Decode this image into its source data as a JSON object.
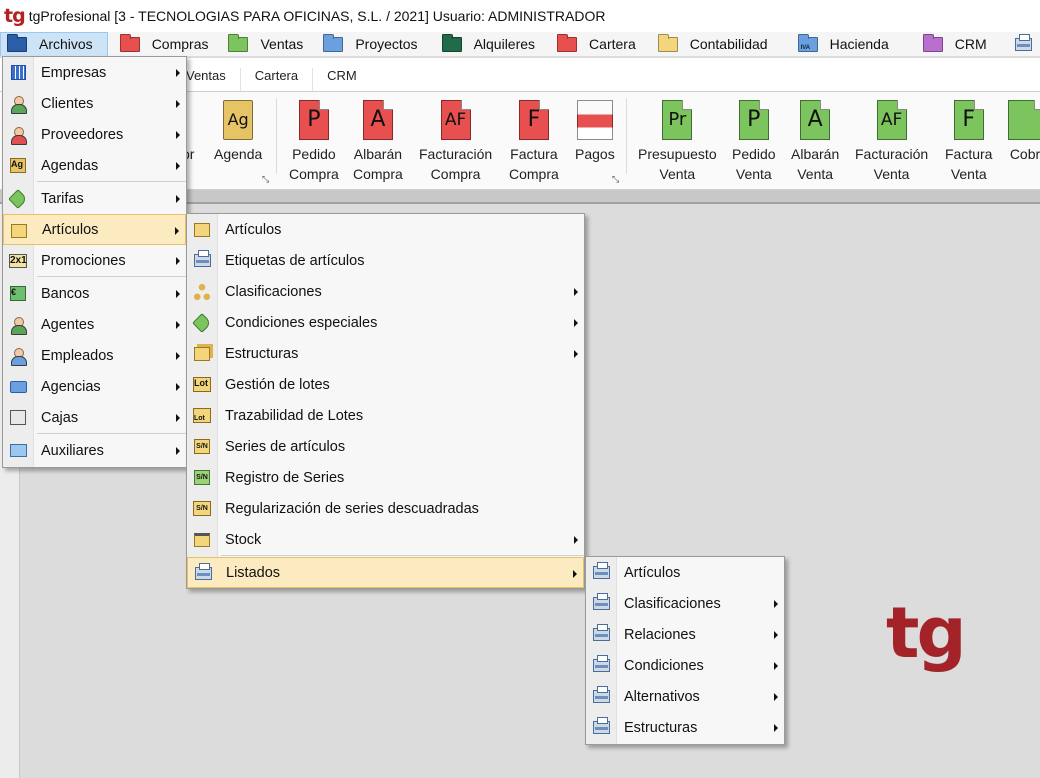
{
  "titlebar": {
    "logo": "tg",
    "title": "tgProfesional [3 - TECNOLOGIAS PARA OFICINAS, S.L. / 2021] Usuario: ADMINISTRADOR"
  },
  "menubar": [
    {
      "label": "Archivos",
      "color": "#2b5ea8",
      "active": true
    },
    {
      "label": "Compras",
      "color": "#e8504f"
    },
    {
      "label": "Ventas",
      "color": "#7cc45d"
    },
    {
      "label": "Proyectos",
      "color": "#6aa0e0"
    },
    {
      "label": "Alquileres",
      "color": "#1f6b4a"
    },
    {
      "label": "Cartera",
      "color": "#e8504f"
    },
    {
      "label": "Contabilidad",
      "color": "#f3d67c"
    },
    {
      "label": "Hacienda",
      "color": "#6aa0e0",
      "badge": "IVA"
    },
    {
      "label": "CRM",
      "color": "#b86fd0"
    }
  ],
  "ribbon": {
    "tabs": [
      "Ventas",
      "Cartera",
      "CRM"
    ],
    "buttons": [
      {
        "letter": "",
        "label1": "or",
        "label2": ""
      },
      {
        "letter": "Ag",
        "label1": "Agenda",
        "label2": ""
      },
      {
        "letter": "P",
        "label1": "Pedido",
        "label2": "Compra"
      },
      {
        "letter": "A",
        "label1": "Albarán",
        "label2": "Compra"
      },
      {
        "letter": "AF",
        "label1": "Facturación",
        "label2": "Compra"
      },
      {
        "letter": "F",
        "label1": "Factura",
        "label2": "Compra"
      },
      {
        "letter": "",
        "label1": "Pagos",
        "label2": ""
      },
      {
        "letter": "Pr",
        "label1": "Presupuesto",
        "label2": "Venta"
      },
      {
        "letter": "P",
        "label1": "Pedido",
        "label2": "Venta"
      },
      {
        "letter": "A",
        "label1": "Albarán",
        "label2": "Venta"
      },
      {
        "letter": "AF",
        "label1": "Facturación",
        "label2": "Venta"
      },
      {
        "letter": "F",
        "label1": "Factura",
        "label2": "Venta"
      },
      {
        "letter": "",
        "label1": "Cobr",
        "label2": ""
      }
    ]
  },
  "archivos_menu": {
    "items": [
      {
        "label": "Empresas",
        "icon": "grid-icon"
      },
      {
        "label": "Clientes",
        "icon": "client-icon"
      },
      {
        "label": "Proveedores",
        "icon": "supplier-icon"
      },
      {
        "label": "Agendas",
        "icon": "agenda-icon"
      },
      {
        "label": "Tarifas",
        "icon": "tag-icon"
      },
      {
        "label": "Artículos",
        "icon": "box-icon"
      },
      {
        "label": "Promociones",
        "icon": "promo-2x1-icon"
      },
      {
        "label": "Bancos",
        "icon": "bank-icon"
      },
      {
        "label": "Agentes",
        "icon": "agent-icon"
      },
      {
        "label": "Empleados",
        "icon": "employee-icon"
      },
      {
        "label": "Agencias",
        "icon": "truck-icon"
      },
      {
        "label": "Cajas",
        "icon": "cash-register-icon"
      },
      {
        "label": "Auxiliares",
        "icon": "folder-icon"
      }
    ]
  },
  "articulos_menu": {
    "items": [
      {
        "label": "Artículos",
        "icon": "box-icon"
      },
      {
        "label": "Etiquetas de artículos",
        "icon": "printer-icon"
      },
      {
        "label": "Clasificaciones",
        "icon": "hierarchy-icon"
      },
      {
        "label": "Condiciones especiales",
        "icon": "tag-icon"
      },
      {
        "label": "Estructuras",
        "icon": "structure-icon"
      },
      {
        "label": "Gestión de lotes",
        "icon": "lot-icon",
        "badge": "Lot"
      },
      {
        "label": "Trazabilidad de Lotes",
        "icon": "lot-trace-icon",
        "badge": "Lot"
      },
      {
        "label": "Series de artículos",
        "icon": "serial-icon",
        "badge": "S/N"
      },
      {
        "label": "Registro de Series",
        "icon": "serial-register-icon",
        "badge": "S/N"
      },
      {
        "label": "Regularización de series descuadradas",
        "icon": "serial-adjust-icon",
        "badge": "S/N"
      },
      {
        "label": "Stock",
        "icon": "stock-icon"
      },
      {
        "label": "Listados",
        "icon": "printer-icon"
      }
    ]
  },
  "listados_menu": {
    "items": [
      {
        "label": "Artículos"
      },
      {
        "label": "Clasificaciones"
      },
      {
        "label": "Relaciones"
      },
      {
        "label": "Condiciones"
      },
      {
        "label": "Alternativos"
      },
      {
        "label": "Estructuras"
      }
    ]
  },
  "watermark": "tg"
}
